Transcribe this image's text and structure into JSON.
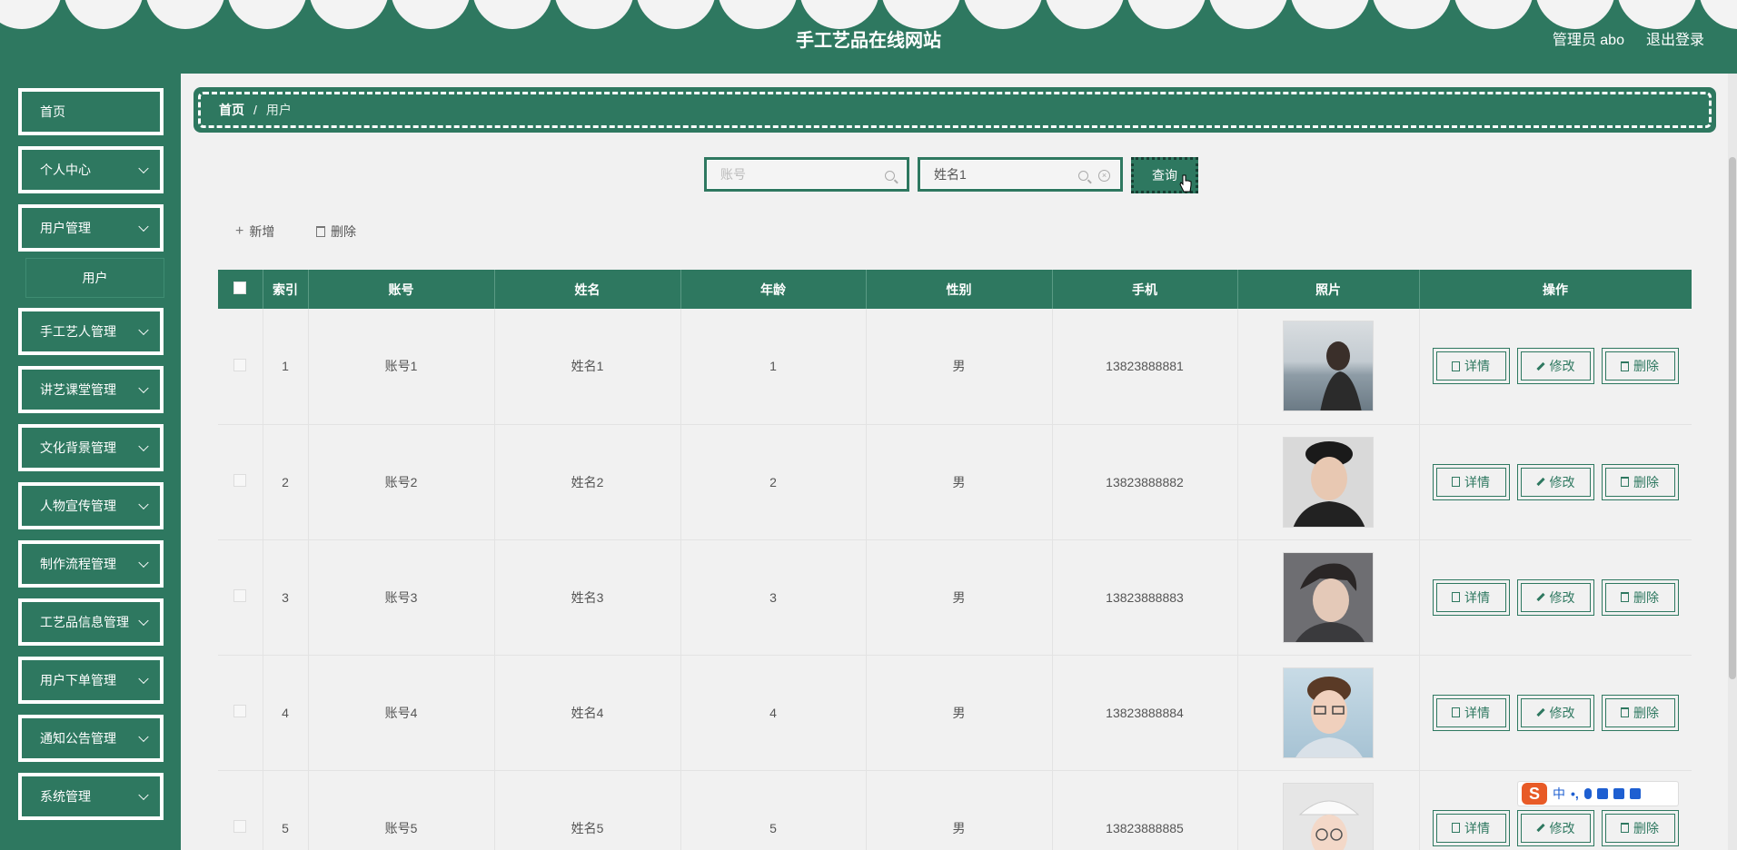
{
  "header": {
    "title": "手工艺品在线网站",
    "user_label": "管理员 abo",
    "logout_label": "退出登录"
  },
  "sidebar": {
    "items": [
      {
        "label": "首页"
      },
      {
        "label": "个人中心"
      },
      {
        "label": "用户管理"
      },
      {
        "label": "手工艺人管理"
      },
      {
        "label": "讲艺课堂管理"
      },
      {
        "label": "文化背景管理"
      },
      {
        "label": "人物宣传管理"
      },
      {
        "label": "制作流程管理"
      },
      {
        "label": "工艺品信息管理"
      },
      {
        "label": "用户下单管理"
      },
      {
        "label": "通知公告管理"
      },
      {
        "label": "系统管理"
      }
    ],
    "submenu": {
      "label": "用户"
    }
  },
  "breadcrumb": {
    "home": "首页",
    "separator": "/",
    "current": "用户"
  },
  "search": {
    "account_placeholder": "账号",
    "account_value": "",
    "name_placeholder": "姓名",
    "name_value": "姓名1",
    "query_label": "查询"
  },
  "actions": {
    "add_label": "新增",
    "delete_label": "删除"
  },
  "table": {
    "headers": [
      "索引",
      "账号",
      "姓名",
      "年龄",
      "性别",
      "手机",
      "照片",
      "操作"
    ],
    "rows": [
      {
        "index": "1",
        "account": "账号1",
        "name": "姓名1",
        "age": "1",
        "gender": "男",
        "phone": "13823888881"
      },
      {
        "index": "2",
        "account": "账号2",
        "name": "姓名2",
        "age": "2",
        "gender": "男",
        "phone": "13823888882"
      },
      {
        "index": "3",
        "account": "账号3",
        "name": "姓名3",
        "age": "3",
        "gender": "男",
        "phone": "13823888883"
      },
      {
        "index": "4",
        "account": "账号4",
        "name": "姓名4",
        "age": "4",
        "gender": "男",
        "phone": "13823888884"
      },
      {
        "index": "5",
        "account": "账号5",
        "name": "姓名5",
        "age": "5",
        "gender": "男",
        "phone": "13823888885"
      }
    ],
    "ops": {
      "detail": "详情",
      "edit": "修改",
      "delete": "删除"
    }
  },
  "ime": {
    "lang": "中"
  },
  "colors": {
    "primary": "#2e7860",
    "background": "#f1f1f1"
  }
}
